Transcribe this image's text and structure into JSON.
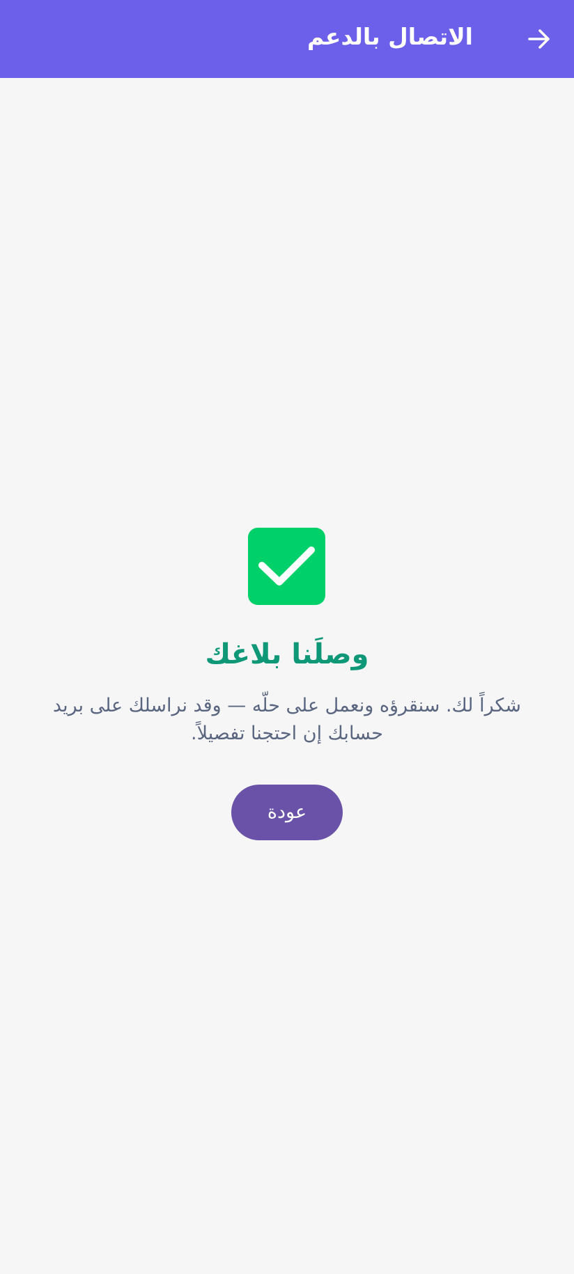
{
  "app_bar": {
    "title": "الاتصال بالدعم",
    "back_icon": "arrow-right-icon",
    "background": "#6c5fe9"
  },
  "confirmation": {
    "icon": "checkmark-box-icon",
    "icon_color": "#00d06a",
    "heading": "وصلَنا بلاغك",
    "heading_color": "#0e9878",
    "message": "شكراً لك. سنقرؤه ونعمل على حلّه — وقد نراسلك على بريد حسابك إن احتجنا تفصيلاً.",
    "back_button_label": "عودة",
    "back_button_color": "#6952a8"
  }
}
